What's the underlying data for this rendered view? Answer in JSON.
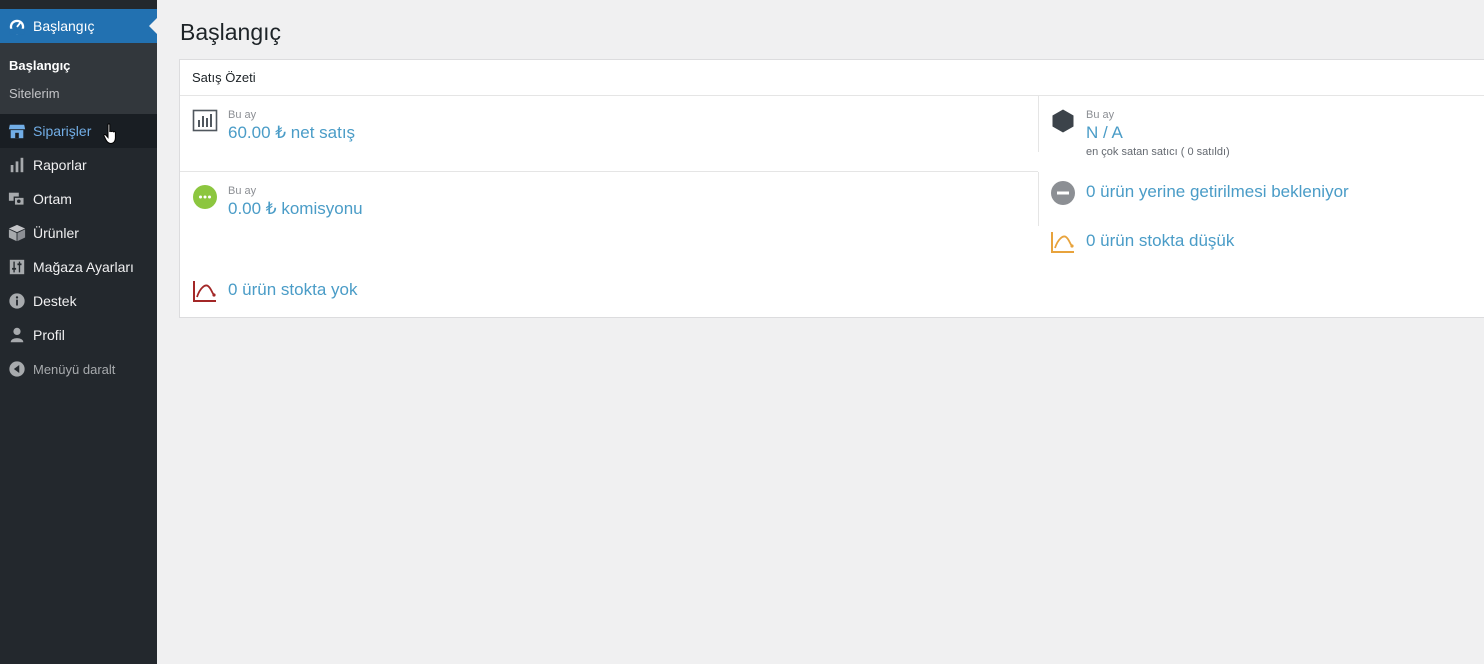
{
  "sidebar": {
    "top": {
      "label": "Başlangıç",
      "icon": "dashboard-icon"
    },
    "submenu": [
      {
        "label": "Başlangıç",
        "current": true
      },
      {
        "label": "Sitelerim",
        "current": false
      }
    ],
    "items": [
      {
        "label": "Siparişler",
        "icon": "store-icon",
        "hover": true
      },
      {
        "label": "Raporlar",
        "icon": "bar-chart-icon"
      },
      {
        "label": "Ortam",
        "icon": "media-icon"
      },
      {
        "label": "Ürünler",
        "icon": "box-icon"
      },
      {
        "label": "Mağaza Ayarları",
        "icon": "settings-sliders-icon"
      },
      {
        "label": "Destek",
        "icon": "info-icon"
      },
      {
        "label": "Profil",
        "icon": "user-icon"
      }
    ],
    "collapse_label": "Menüyü daralt"
  },
  "page": {
    "title": "Başlangıç"
  },
  "panel": {
    "title": "Satış Özeti",
    "net_sales": {
      "period": "Bu ay",
      "value": "60.00 ₺ net satış"
    },
    "commission": {
      "period": "Bu ay",
      "value": "0.00 ₺ komisyonu"
    },
    "out_of_stock": {
      "value": "0 ürün stokta yok"
    },
    "top_seller": {
      "period": "Bu ay",
      "value": "N / A",
      "caption": "en çok satan satıcı ( 0 satıldı)"
    },
    "awaiting": {
      "value": "0 ürün yerine getirilmesi bekleniyor"
    },
    "low_stock": {
      "value": "0 ürün stokta düşük"
    }
  },
  "colors": {
    "sidebar_bg": "#23282d",
    "active_menu": "#2271b1",
    "link": "#4a9cc7",
    "commission_green": "#8cc63f",
    "out_of_stock_red": "#a32727",
    "low_stock_orange": "#e8a33c",
    "awaiting_grey": "#8c8f94"
  }
}
